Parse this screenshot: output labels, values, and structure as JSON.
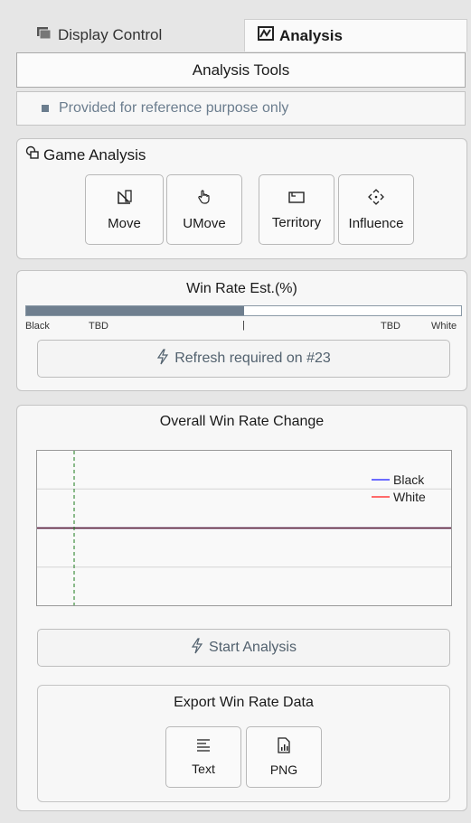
{
  "tabs": [
    {
      "label": "Display Control",
      "icon": "layers-icon",
      "active": false
    },
    {
      "label": "Analysis",
      "icon": "chart-icon",
      "active": true
    }
  ],
  "header": {
    "title": "Analysis Tools"
  },
  "notice": {
    "text": "Provided for reference purpose only"
  },
  "game_analysis": {
    "title": "Game Analysis",
    "icon": "analysis-icon",
    "buttons": [
      {
        "label": "Move",
        "icon": "move-icon"
      },
      {
        "label": "UMove",
        "icon": "hand-icon"
      },
      {
        "label": "Territory",
        "icon": "territory-icon"
      },
      {
        "label": "Influence",
        "icon": "influence-icon"
      }
    ]
  },
  "win_rate": {
    "title": "Win Rate Est.(%)",
    "black_fraction": 0.5,
    "left_label": "Black",
    "black_value": "TBD",
    "divider": "|",
    "white_value": "TBD",
    "right_label": "White",
    "refresh_label": "Refresh required on #23",
    "colors": {
      "black_fill": "#6f7f8f",
      "white_fill": "#ffffff"
    }
  },
  "overall": {
    "title": "Overall Win Rate Change",
    "start_label": "Start Analysis"
  },
  "chart_data": {
    "type": "line",
    "title": "",
    "xlabel": "",
    "ylabel": "",
    "ylim": [
      0,
      100
    ],
    "grid": true,
    "legend": "top-right",
    "current_move_marker": true,
    "series": [
      {
        "name": "Black",
        "color": "#6b6bff",
        "values": [
          50,
          50
        ]
      },
      {
        "name": "White",
        "color": "#ff6b6b",
        "values": [
          50,
          50
        ]
      }
    ]
  },
  "export": {
    "title": "Export Win Rate Data",
    "buttons": [
      {
        "label": "Text",
        "icon": "text-lines-icon"
      },
      {
        "label": "PNG",
        "icon": "image-file-icon"
      }
    ]
  }
}
